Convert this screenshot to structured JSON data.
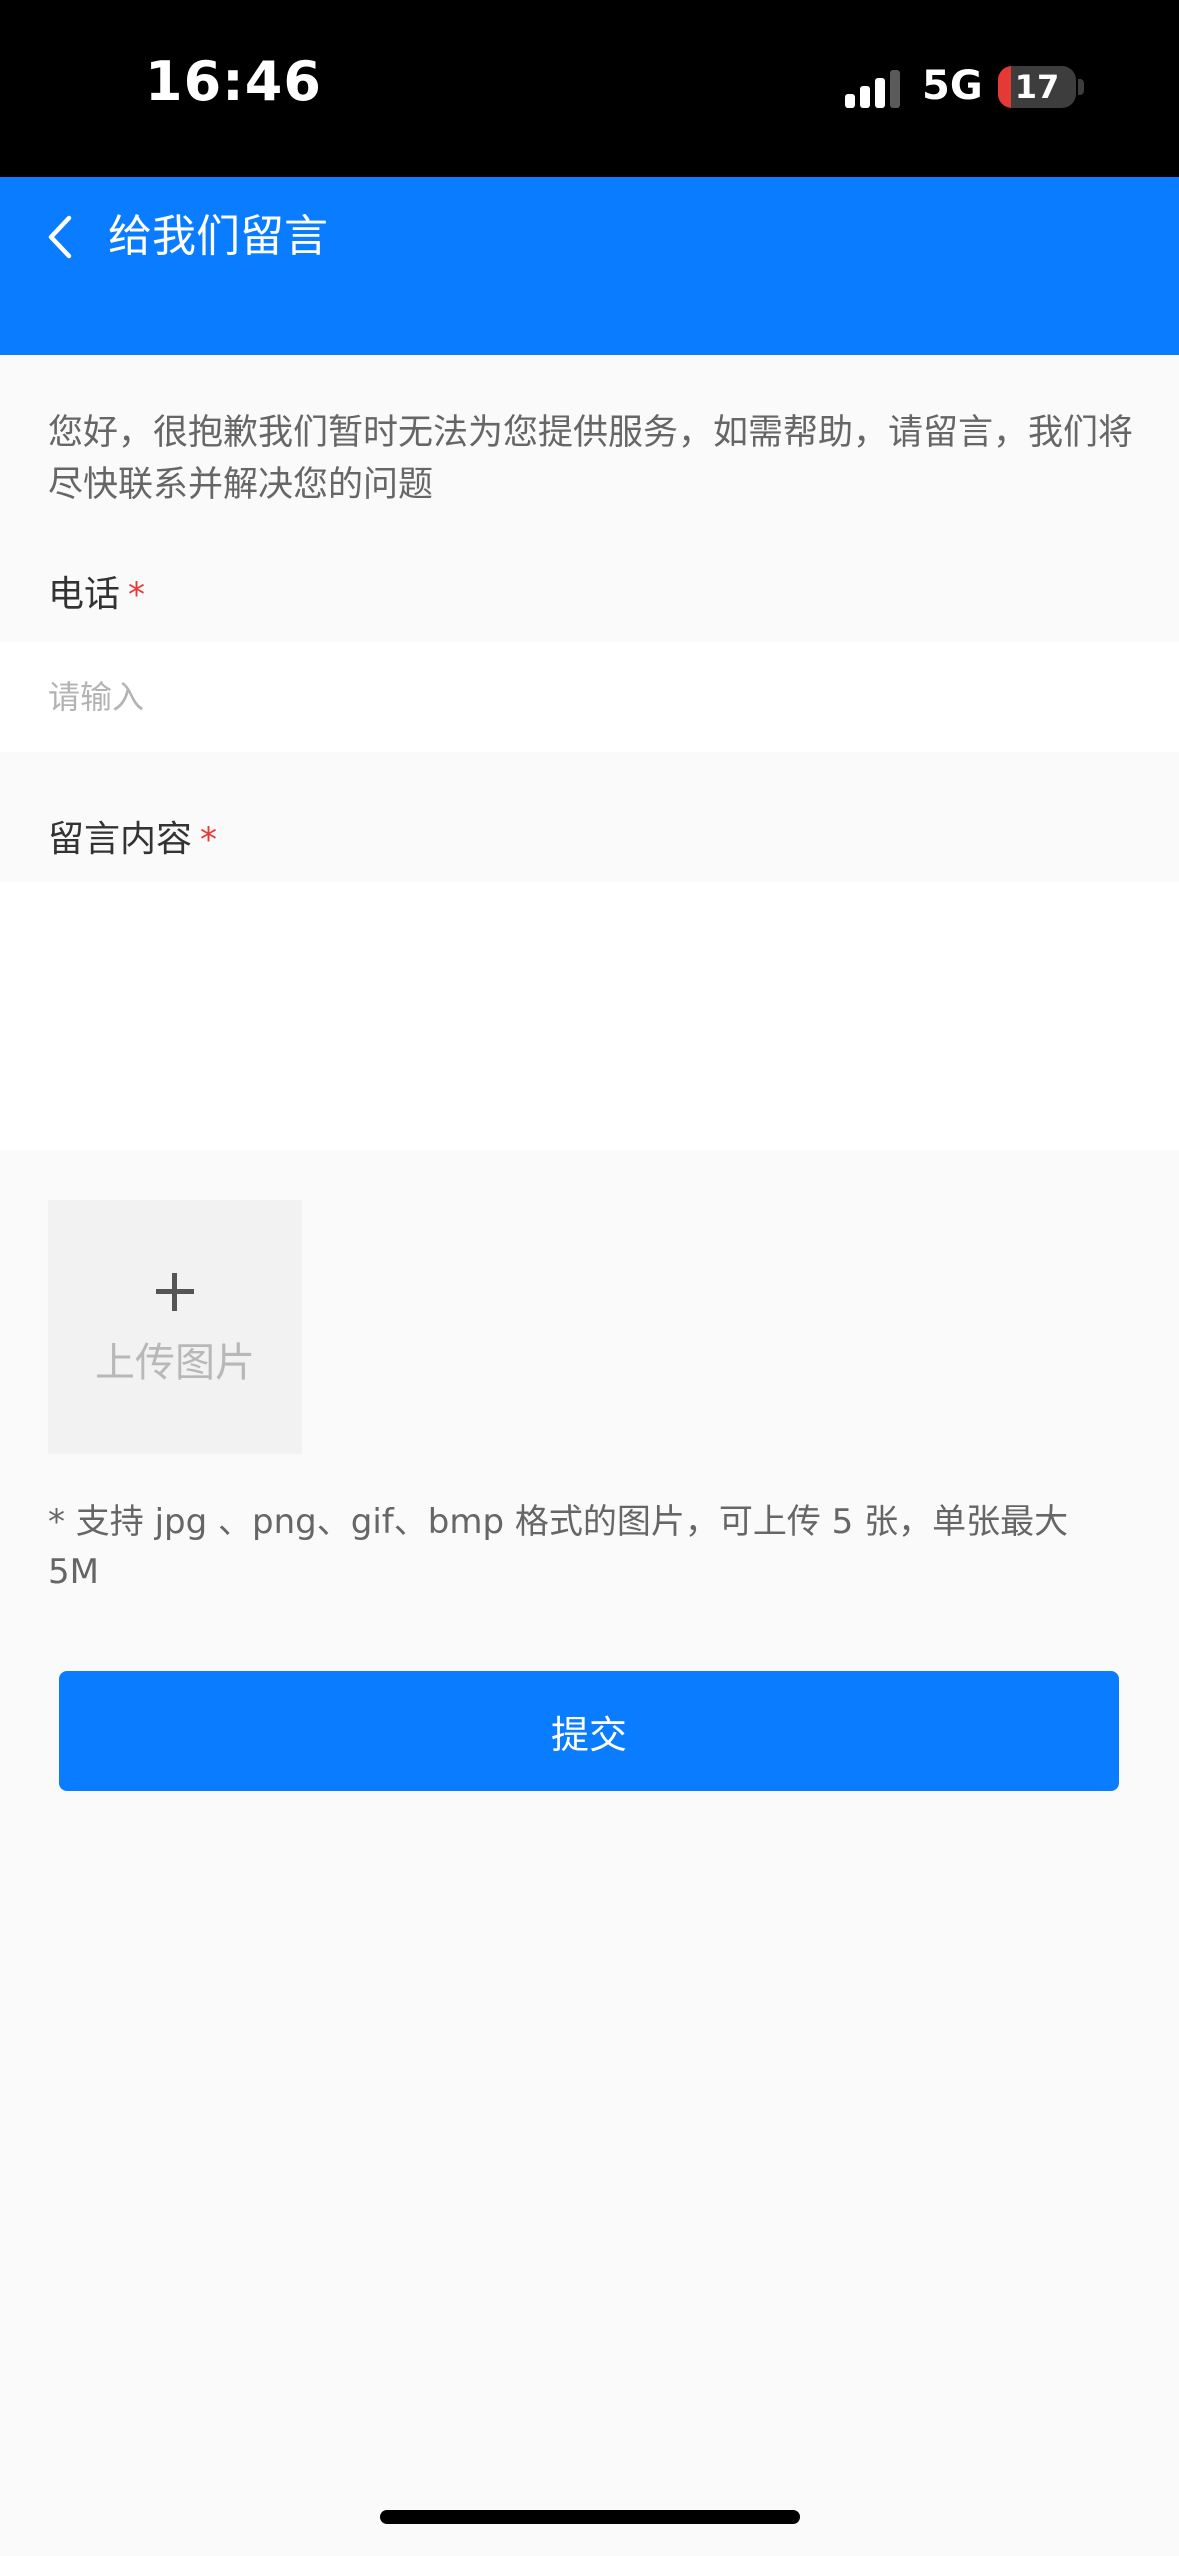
{
  "status_bar": {
    "time": "16:46",
    "network": "5G",
    "battery_level": "17",
    "battery_fraction": 0.17,
    "signal_bars_active": 3,
    "signal_bars_total": 4
  },
  "nav": {
    "back_icon": "chevron-left-icon",
    "title": "给我们留言"
  },
  "form": {
    "notice": "您好，很抱歉我们暂时无法为您提供服务，如需帮助，请留言，我们将尽快联系并解决您的问题",
    "required_mark": "*",
    "phone": {
      "label": "电话",
      "value": "",
      "placeholder": "请输入"
    },
    "message": {
      "label": "留言内容",
      "value": "",
      "placeholder": ""
    },
    "upload": {
      "icon": "plus-icon",
      "label": "上传图片",
      "tip": "* 支持 jpg 、png、gif、bmp 格式的图片，可上传 5 张，单张最大 5M"
    },
    "submit_label": "提交"
  },
  "colors": {
    "primary": "#0a7cff",
    "required": "#e53935",
    "page_background": "#fafafa"
  }
}
